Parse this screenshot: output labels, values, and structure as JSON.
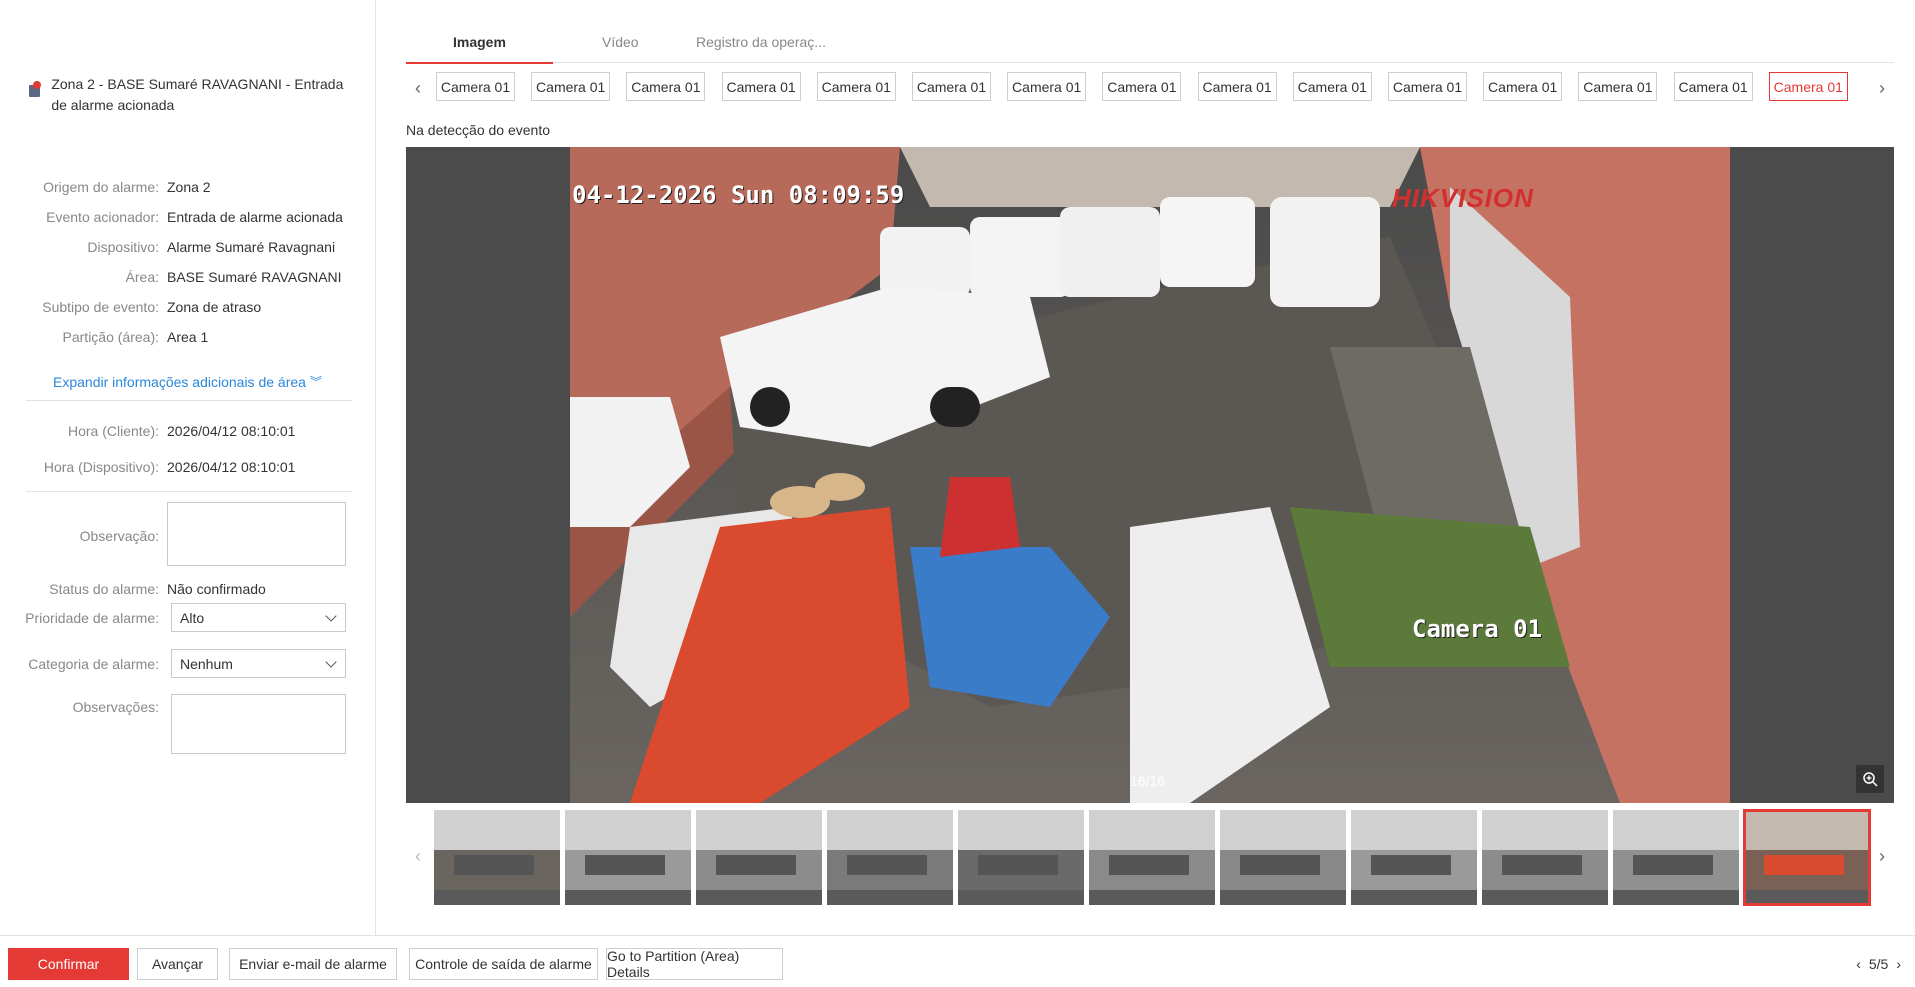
{
  "alarm": {
    "title": "Zona 2 - BASE Sumaré RAVAGNANI - Entrada de alarme acionada"
  },
  "info": [
    {
      "label": "Origem do alarme:",
      "value": "Zona 2"
    },
    {
      "label": "Evento acionador:",
      "value": "Entrada de alarme acionada"
    },
    {
      "label": "Dispositivo:",
      "value": "Alarme Sumaré Ravagnani"
    },
    {
      "label": "Área:",
      "value": "BASE Sumaré RAVAGNANI"
    },
    {
      "label": "Subtipo de evento:",
      "value": "Zona de atraso"
    },
    {
      "label": "Partição (área):",
      "value": "Area 1"
    }
  ],
  "expand_label": "Expandir informações adicionais de área",
  "times": [
    {
      "label": "Hora (Cliente):",
      "value": "2026/04/12 08:10:01"
    },
    {
      "label": "Hora (Dispositivo):",
      "value": "2026/04/12 08:10:01"
    }
  ],
  "form": {
    "observacao_label": "Observação:",
    "status_label": "Status do alarme:",
    "status_value": "Não confirmado",
    "priority_label": "Prioridade de alarme:",
    "priority_value": "Alto",
    "category_label": "Categoria de alarme:",
    "category_value": "Nenhum",
    "observacoes_label": "Observações:"
  },
  "tabs": [
    {
      "label": "Imagem"
    },
    {
      "label": "Vídeo"
    },
    {
      "label": "Registro da operaç..."
    }
  ],
  "cameras": [
    "Camera 01",
    "Camera 01",
    "Camera 01",
    "Camera 01",
    "Camera 01",
    "Camera 01",
    "Camera 01",
    "Camera 01",
    "Camera 01",
    "Camera 01",
    "Camera 01",
    "Camera 01",
    "Camera 01",
    "Camera 01",
    "Camera 01"
  ],
  "selected_camera_index": 14,
  "detect_label": "Na detecção do evento",
  "viewer": {
    "osd_time": "04-12-2026 Sun 08:09:59",
    "osd_camera": "Camera 01",
    "osd_brand": "HIKVISION",
    "frame_counter": "16/16"
  },
  "buttons": {
    "confirm": "Confirmar",
    "advance": "Avançar",
    "email": "Enviar e-mail de alarme",
    "output": "Controle de saída de alarme",
    "partition": "Go to Partition (Area) Details"
  },
  "pager": "5/5",
  "colors": {
    "accent": "#e53935",
    "link": "#2a86d9"
  }
}
